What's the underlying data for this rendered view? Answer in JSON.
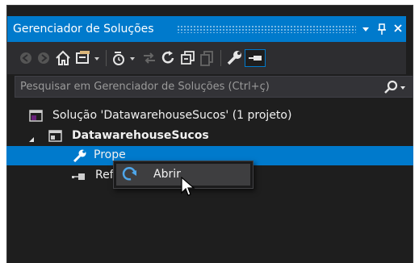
{
  "panel": {
    "title": "Gerenciador de Soluções",
    "dropdown_icon": "chevron-down-icon",
    "pin_icon": "pin-icon",
    "close_icon": "close-icon"
  },
  "toolbar": {
    "buttons": [
      "back-icon",
      "forward-icon",
      "home-icon",
      "switch-views-icon",
      "pending-changes-icon",
      "sync-icon",
      "refresh-icon",
      "collapse-all-icon",
      "show-all-files-icon",
      "properties-icon",
      "preview-icon"
    ]
  },
  "search": {
    "placeholder": "Pesquisar em Gerenciador de Soluções (Ctrl+ç)",
    "icon": "search-icon"
  },
  "tree": {
    "solution": "Solução 'DatawarehouseSucos' (1 projeto)",
    "project": "DatawarehouseSucos",
    "properties": "Properties",
    "references": "Referências"
  },
  "context_menu": {
    "open_label": "Abrir",
    "open_icon": "redo-arrow-icon"
  },
  "colors": {
    "accent": "#007acc",
    "background": "#1e1e1e",
    "toolbar": "#2d2d30"
  }
}
